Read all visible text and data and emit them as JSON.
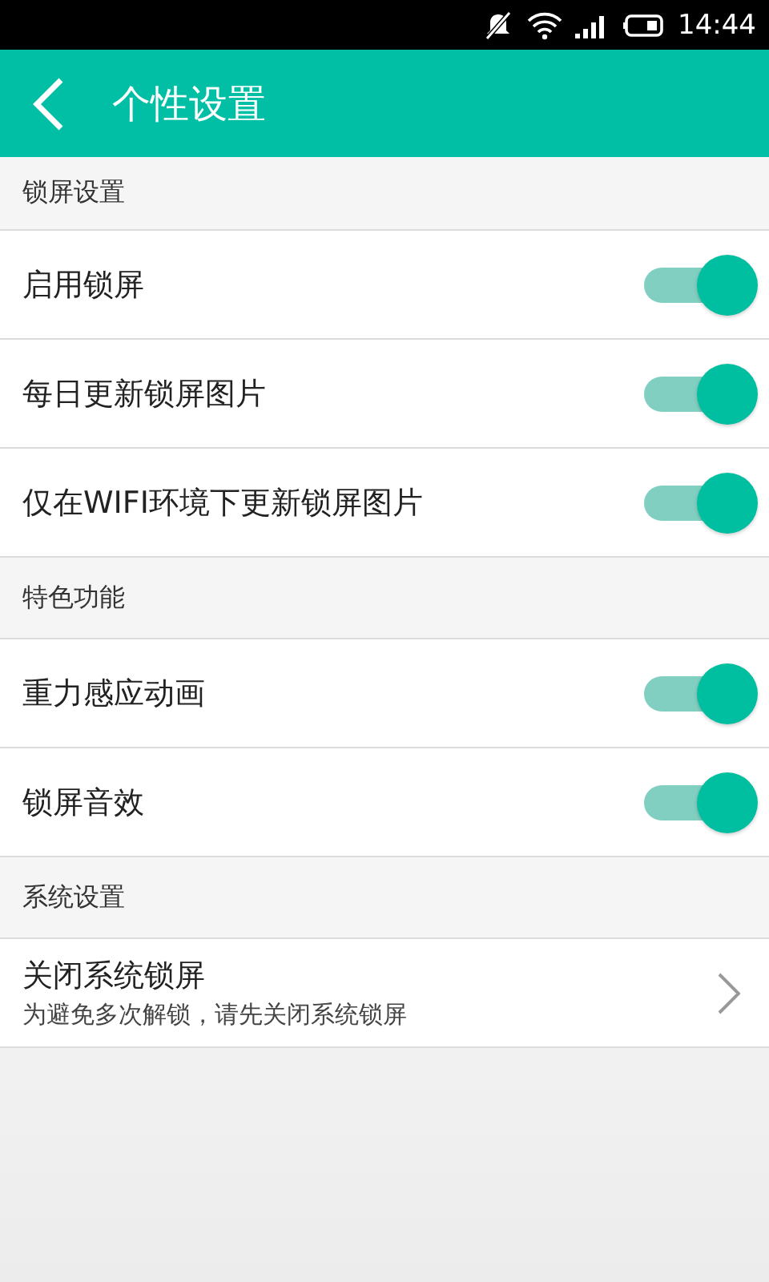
{
  "status_bar": {
    "time": "14:44"
  },
  "header": {
    "title": "个性设置"
  },
  "sections": [
    {
      "title": "锁屏设置",
      "items": [
        {
          "kind": "toggle",
          "label": "启用锁屏",
          "on": true
        },
        {
          "kind": "toggle",
          "label": "每日更新锁屏图片",
          "on": true
        },
        {
          "kind": "toggle",
          "label": "仅在WIFI环境下更新锁屏图片",
          "on": true
        }
      ]
    },
    {
      "title": "特色功能",
      "items": [
        {
          "kind": "toggle",
          "label": "重力感应动画",
          "on": true
        },
        {
          "kind": "toggle",
          "label": "锁屏音效",
          "on": true
        }
      ]
    },
    {
      "title": "系统设置",
      "items": [
        {
          "kind": "link",
          "label": "关闭系统锁屏",
          "subtitle": "为避免多次解锁，请先关闭系统锁屏"
        }
      ]
    }
  ]
}
